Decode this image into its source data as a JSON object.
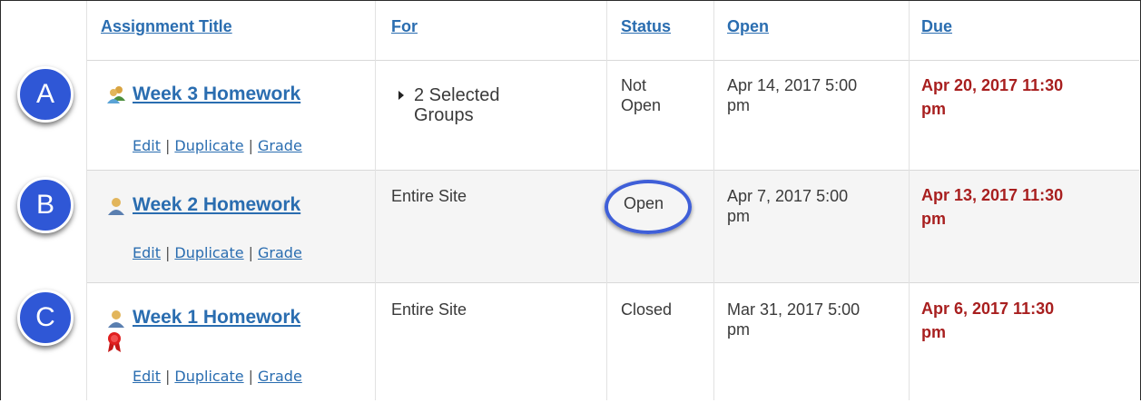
{
  "columns": {
    "title": "Assignment Title",
    "for": "For",
    "status": "Status",
    "open": "Open",
    "due": "Due"
  },
  "rows": [
    {
      "badge": "A",
      "title": "Week 3 Homework",
      "icon": "group-users-icon",
      "for": "2 Selected Groups",
      "for_line1": "2 Selected",
      "for_line2": "Groups",
      "status_line1": "Not",
      "status_line2": "Open",
      "open_line1": "Apr 14, 2017 5:00",
      "open_line2": "pm",
      "due_line1": "Apr 20, 2017 11:30",
      "due_line2": "pm",
      "actions": {
        "edit": "Edit",
        "duplicate": "Duplicate",
        "grade": "Grade",
        "sep": "|"
      }
    },
    {
      "badge": "B",
      "title": "Week 2 Homework",
      "icon": "user-icon",
      "for_line1": "Entire Site",
      "status_line1": "Open",
      "open_line1": "Apr 7, 2017 5:00",
      "open_line2": "pm",
      "due_line1": "Apr 13, 2017 11:30",
      "due_line2": "pm",
      "actions": {
        "edit": "Edit",
        "duplicate": "Duplicate",
        "grade": "Grade",
        "sep": "|"
      }
    },
    {
      "badge": "C",
      "title": "Week 1 Homework",
      "icon": "user-icon",
      "extra_icon": "award-ribbon-icon",
      "for_line1": "Entire Site",
      "status_line1": "Closed",
      "open_line1": "Mar 31, 2017 5:00",
      "open_line2": "pm",
      "due_line1": "Apr 6, 2017 11:30",
      "due_line2": "pm",
      "actions": {
        "edit": "Edit",
        "duplicate": "Duplicate",
        "grade": "Grade",
        "sep": "|"
      }
    }
  ],
  "colors": {
    "link": "#2a6db0",
    "due": "#a81f1f",
    "badge": "#2f57d6",
    "alt_row": "#f5f5f5"
  }
}
